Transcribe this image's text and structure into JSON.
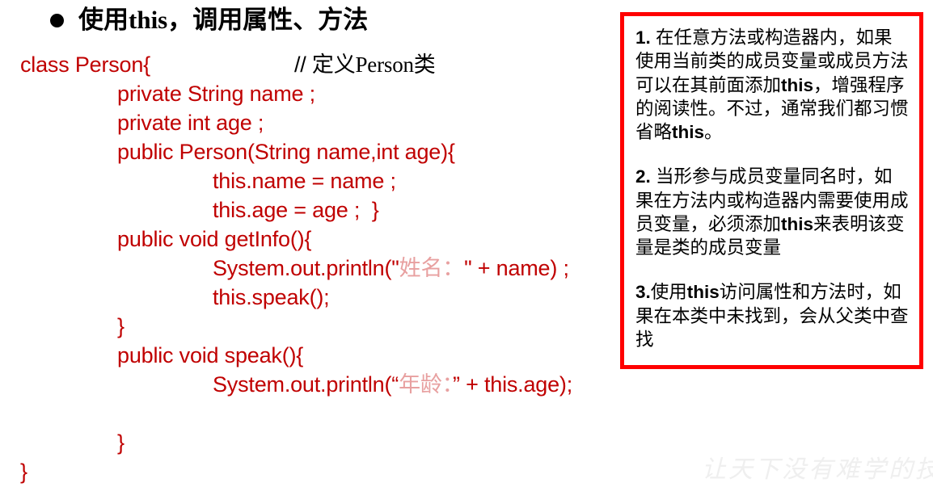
{
  "slide": {
    "title": {
      "bullet_icon": "filled-circle-bullet",
      "text": "使用this，调用属性、方法"
    },
    "code": {
      "text_color": "#C00000",
      "comment_color": "#000000",
      "string_cn_color": "#E8A0A0",
      "lines": [
        {
          "indent": 0,
          "text": "class Person{",
          "comment": "// 定义Person类"
        },
        {
          "indent": 1,
          "text": "private String name ;"
        },
        {
          "indent": 1,
          "text": "private int age ;"
        },
        {
          "indent": 1,
          "text": "public Person(String name,int age){"
        },
        {
          "indent": 2,
          "text": "this.name = name ;"
        },
        {
          "indent": 2,
          "text": "this.age = age ;  }"
        },
        {
          "indent": 1,
          "text": "public void getInfo(){"
        },
        {
          "indent": 2,
          "pre": "System.out.println(\"",
          "cn": "姓名：",
          "post": "\" + name) ;"
        },
        {
          "indent": 2,
          "text": "this.speak();"
        },
        {
          "indent": 1,
          "text": "}"
        },
        {
          "indent": 1,
          "text": "public void speak(){"
        },
        {
          "indent": 2,
          "pre": "System.out.println(“",
          "cn": "年龄：",
          "post": "” + this.age);"
        },
        {
          "indent": 0,
          "text": ""
        },
        {
          "indent": 1,
          "text": "}"
        },
        {
          "indent": 0,
          "text": "}"
        }
      ]
    },
    "note_box": {
      "border_color": "#FF0000",
      "paragraphs": [
        {
          "number": "1.",
          "segments": [
            {
              "t": "在任意方法或构造器内，如果使用当前类的成员变量或成员方法可以在其前面添加",
              "bold": false
            },
            {
              "t": "this",
              "bold": true
            },
            {
              "t": "，增强程序的阅读性。不过，通常我们都习惯省略",
              "bold": false
            },
            {
              "t": "this",
              "bold": true
            },
            {
              "t": "。",
              "bold": false
            }
          ]
        },
        {
          "number": "2.",
          "segments": [
            {
              "t": "当形参与成员变量同名时，如果在方法内或构造器内需要使用成员变量，必须添加",
              "bold": false
            },
            {
              "t": "this",
              "bold": true
            },
            {
              "t": "来表明该变量是类的成员变量",
              "bold": false
            }
          ]
        },
        {
          "number": "3.",
          "segments": [
            {
              "t": "使用",
              "bold": false
            },
            {
              "t": "this",
              "bold": true
            },
            {
              "t": "访问属性和方法时，如果在本类中未找到，会从父类中查找",
              "bold": false
            }
          ]
        }
      ]
    },
    "watermark": {
      "text": "让天下没有难学的技术"
    }
  }
}
